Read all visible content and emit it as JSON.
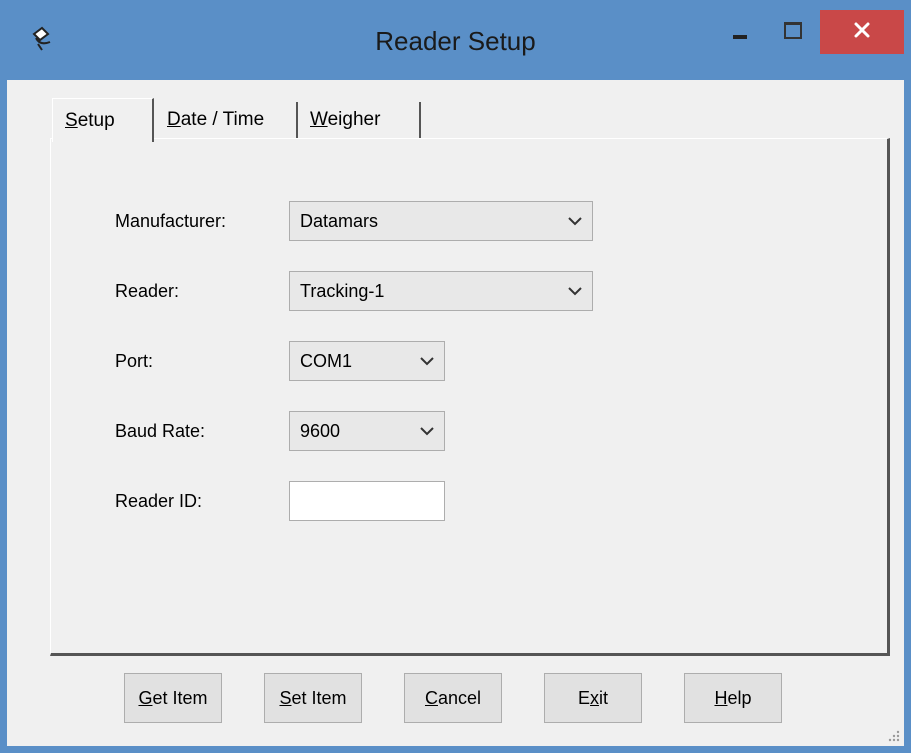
{
  "window": {
    "title": "Reader Setup",
    "icons": {
      "app": "satellite-dish-icon",
      "minimize": "minimize-icon",
      "maximize": "maximize-icon",
      "close": "close-icon"
    }
  },
  "tabs": [
    {
      "label": "Setup",
      "accel": "S",
      "rest": "etup",
      "selected": true
    },
    {
      "label": "Date / Time",
      "accel": "D",
      "rest": "ate / Time",
      "selected": false
    },
    {
      "label": "Weigher",
      "accel": "W",
      "rest": "eigher",
      "selected": false
    }
  ],
  "form": {
    "manufacturer": {
      "label": "Manufacturer:",
      "value": "Datamars"
    },
    "reader": {
      "label": "Reader:",
      "value": "Tracking-1"
    },
    "port": {
      "label": "Port:",
      "value": "COM1"
    },
    "baud_rate": {
      "label": "Baud Rate:",
      "value": "9600"
    },
    "reader_id": {
      "label": "Reader ID:",
      "value": ""
    }
  },
  "buttons": {
    "get_item": {
      "label": "Get Item",
      "accel": "G",
      "rest": "et Item"
    },
    "set_item": {
      "label": "Set Item",
      "accel": "S",
      "rest": "et Item"
    },
    "cancel": {
      "label": "Cancel",
      "accel": "C",
      "rest": "ancel"
    },
    "exit": {
      "label": "Exit",
      "pre": "E",
      "accel": "x",
      "rest": "it"
    },
    "help": {
      "label": "Help",
      "accel": "H",
      "rest": "elp"
    }
  },
  "colors": {
    "title_bar": "#5a8fc7",
    "close_button": "#c94848",
    "client": "#f0f0f0"
  }
}
